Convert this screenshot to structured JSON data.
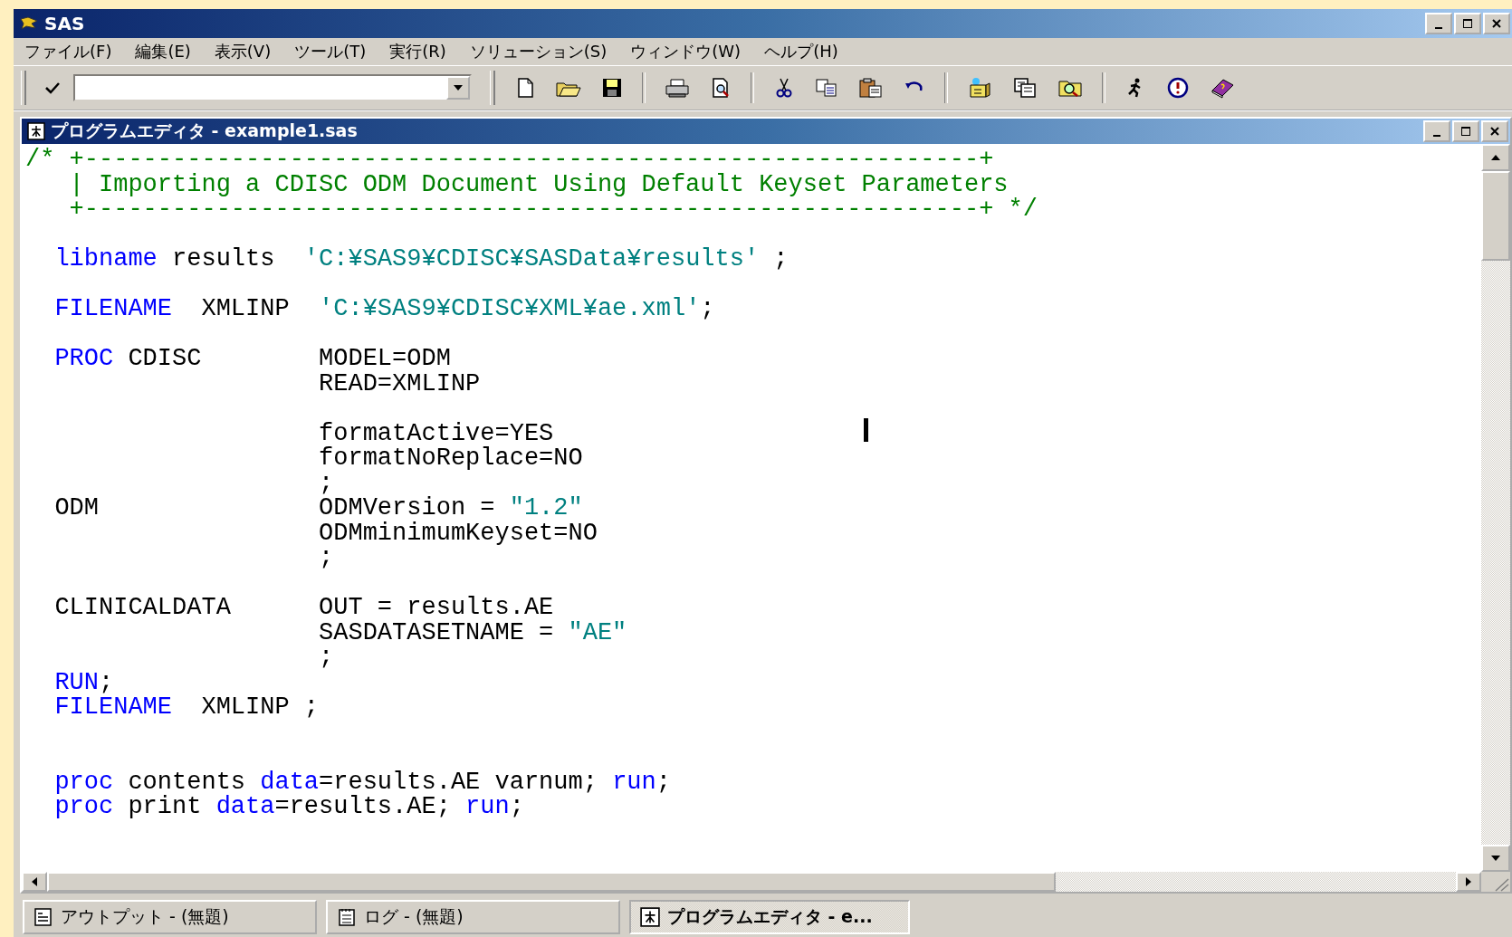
{
  "window": {
    "title": "SAS"
  },
  "menu": [
    {
      "label": "ファイル(F)"
    },
    {
      "label": "編集(E)"
    },
    {
      "label": "表示(V)"
    },
    {
      "label": "ツール(T)"
    },
    {
      "label": "実行(R)"
    },
    {
      "label": "ソリューション(S)"
    },
    {
      "label": "ウィンドウ(W)"
    },
    {
      "label": "ヘルプ(H)"
    }
  ],
  "editor": {
    "title": "プログラムエディタ - example1.sas",
    "lines": [
      {
        "kind": "code",
        "tokens": [
          {
            "kind": "comment",
            "text": "/* +-------------------------------------------------------------+"
          }
        ]
      },
      {
        "kind": "code",
        "tokens": [
          {
            "kind": "comment",
            "text": "   | Importing a CDISC ODM Document Using Default Keyset Parameters"
          }
        ]
      },
      {
        "kind": "code",
        "tokens": [
          {
            "kind": "comment",
            "text": "   +-------------------------------------------------------------+ */"
          }
        ]
      },
      {
        "kind": "blank"
      },
      {
        "kind": "code",
        "tokens": [
          {
            "kind": "keyword",
            "text": "  libname"
          },
          {
            "kind": "plain",
            "text": " results  "
          },
          {
            "kind": "string",
            "text": "'C:¥SAS9¥CDISC¥SASData¥results'"
          },
          {
            "kind": "plain",
            "text": " ;"
          }
        ]
      },
      {
        "kind": "blank"
      },
      {
        "kind": "code",
        "tokens": [
          {
            "kind": "keyword",
            "text": "  FILENAME"
          },
          {
            "kind": "plain",
            "text": "  XMLINP  "
          },
          {
            "kind": "string",
            "text": "'C:¥SAS9¥CDISC¥XML¥ae.xml'"
          },
          {
            "kind": "plain",
            "text": ";"
          }
        ]
      },
      {
        "kind": "blank"
      },
      {
        "kind": "code",
        "tokens": [
          {
            "kind": "keyword",
            "text": "  PROC"
          },
          {
            "kind": "plain",
            "text": " CDISC        MODEL=ODM"
          }
        ]
      },
      {
        "kind": "code",
        "tokens": [
          {
            "kind": "plain",
            "text": "                    READ=XMLINP"
          }
        ]
      },
      {
        "kind": "blank"
      },
      {
        "kind": "code",
        "tokens": [
          {
            "kind": "plain",
            "text": "                    formatActive=YES"
          }
        ]
      },
      {
        "kind": "code",
        "tokens": [
          {
            "kind": "plain",
            "text": "                    formatNoReplace=NO"
          }
        ]
      },
      {
        "kind": "code",
        "tokens": [
          {
            "kind": "plain",
            "text": "                    ;"
          }
        ]
      },
      {
        "kind": "code",
        "tokens": [
          {
            "kind": "plain",
            "text": "  ODM               ODMVersion = "
          },
          {
            "kind": "string",
            "text": "\"1.2\""
          }
        ]
      },
      {
        "kind": "code",
        "tokens": [
          {
            "kind": "plain",
            "text": "                    ODMminimumKeyset=NO"
          }
        ]
      },
      {
        "kind": "code",
        "tokens": [
          {
            "kind": "plain",
            "text": "                    ;"
          }
        ]
      },
      {
        "kind": "blank"
      },
      {
        "kind": "code",
        "tokens": [
          {
            "kind": "plain",
            "text": "  CLINICALDATA      OUT = results.AE"
          }
        ]
      },
      {
        "kind": "code",
        "tokens": [
          {
            "kind": "plain",
            "text": "                    SASDATASETNAME = "
          },
          {
            "kind": "string",
            "text": "\"AE\""
          }
        ]
      },
      {
        "kind": "code",
        "tokens": [
          {
            "kind": "plain",
            "text": "                    ;"
          }
        ]
      },
      {
        "kind": "code",
        "tokens": [
          {
            "kind": "keyword",
            "text": "  RUN"
          },
          {
            "kind": "plain",
            "text": ";"
          }
        ]
      },
      {
        "kind": "code",
        "tokens": [
          {
            "kind": "keyword",
            "text": "  FILENAME"
          },
          {
            "kind": "plain",
            "text": "  XMLINP ;"
          }
        ]
      },
      {
        "kind": "blank"
      },
      {
        "kind": "blank"
      },
      {
        "kind": "code",
        "tokens": [
          {
            "kind": "keyword",
            "text": "  proc"
          },
          {
            "kind": "plain",
            "text": " contents "
          },
          {
            "kind": "keyword",
            "text": "data"
          },
          {
            "kind": "plain",
            "text": "=results.AE varnum; "
          },
          {
            "kind": "keyword",
            "text": "run"
          },
          {
            "kind": "plain",
            "text": ";"
          }
        ]
      },
      {
        "kind": "code",
        "tokens": [
          {
            "kind": "keyword",
            "text": "  proc"
          },
          {
            "kind": "plain",
            "text": " print "
          },
          {
            "kind": "keyword",
            "text": "data"
          },
          {
            "kind": "plain",
            "text": "=results.AE; "
          },
          {
            "kind": "keyword",
            "text": "run"
          },
          {
            "kind": "plain",
            "text": ";"
          }
        ]
      }
    ]
  },
  "taskbar": [
    {
      "kind": "output",
      "label": "アウトプット - (無題)",
      "selected": false
    },
    {
      "kind": "log",
      "label": "ログ - (無題)",
      "selected": false
    },
    {
      "kind": "editor",
      "label": "プログラムエディタ - e...",
      "selected": true
    }
  ]
}
